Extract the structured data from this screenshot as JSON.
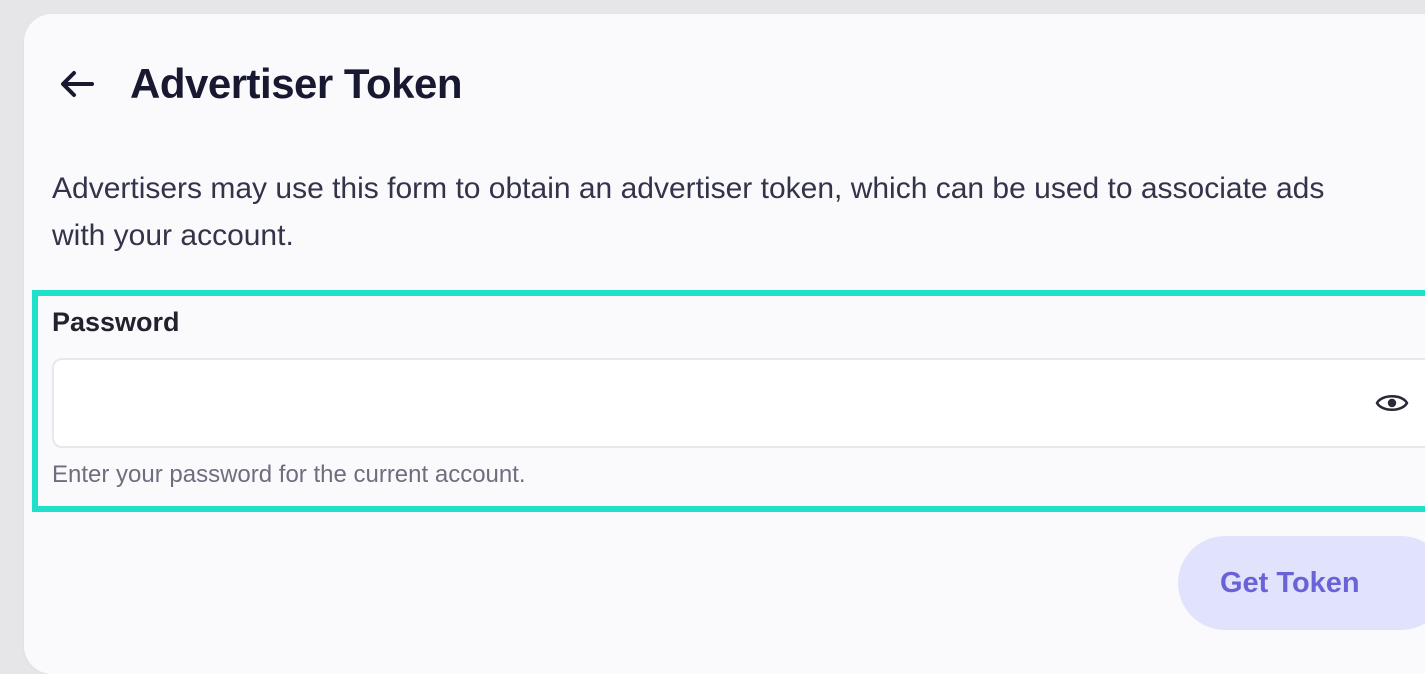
{
  "header": {
    "title": "Advertiser Token",
    "back_icon": "arrow-left-icon"
  },
  "description": "Advertisers may use this form to obtain an advertiser token, which can be used to associate ads with your account.",
  "password_field": {
    "label": "Password",
    "value": "",
    "placeholder": "",
    "hint": "Enter your password for the current account.",
    "toggle_icon": "eye-icon"
  },
  "actions": {
    "get_token_label": "Get Token"
  },
  "colors": {
    "highlight": "#1fe0c9",
    "button_bg": "#e1e3fc",
    "button_text": "#6a63d8"
  }
}
